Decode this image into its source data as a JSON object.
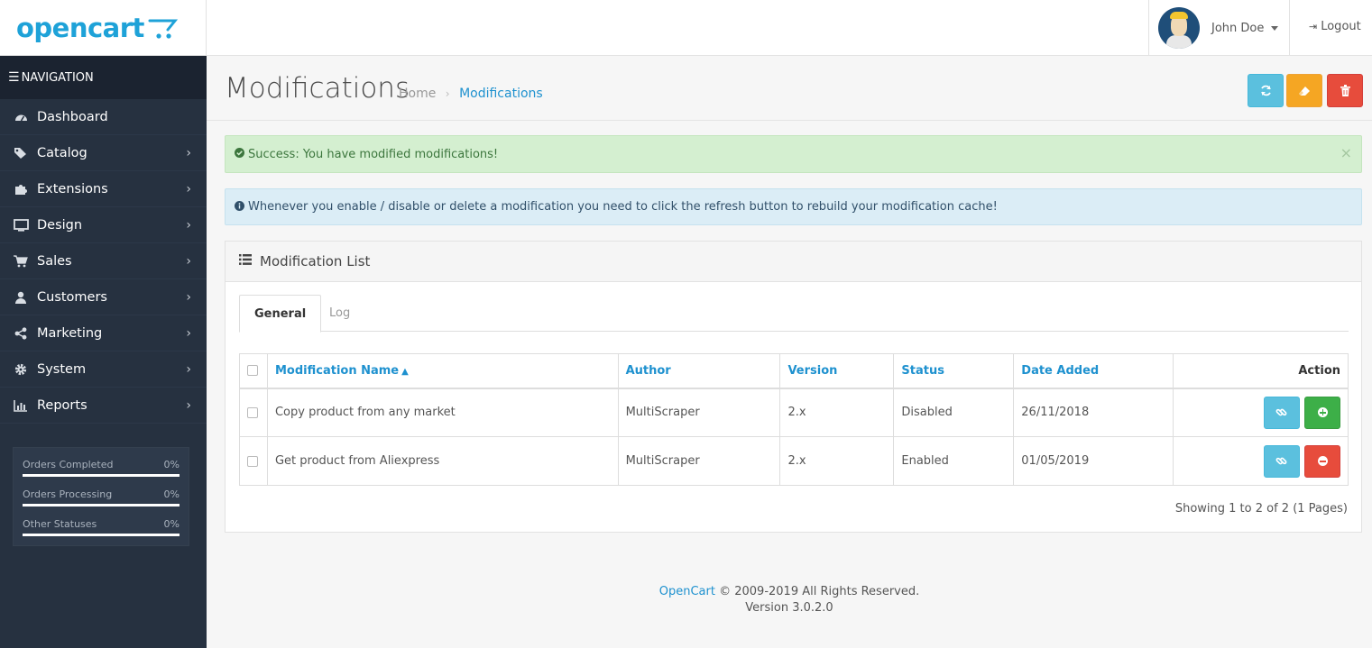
{
  "header": {
    "logo_text": "opencart",
    "user_name": "John Doe",
    "logout_label": "Logout"
  },
  "sidebar": {
    "nav_title": "NAVIGATION",
    "items": [
      {
        "label": "Dashboard",
        "icon": "dashboard-icon",
        "has_children": false
      },
      {
        "label": "Catalog",
        "icon": "tags-icon",
        "has_children": true
      },
      {
        "label": "Extensions",
        "icon": "puzzle-icon",
        "has_children": true
      },
      {
        "label": "Design",
        "icon": "desktop-icon",
        "has_children": true
      },
      {
        "label": "Sales",
        "icon": "cart-icon",
        "has_children": true
      },
      {
        "label": "Customers",
        "icon": "user-icon",
        "has_children": true
      },
      {
        "label": "Marketing",
        "icon": "share-icon",
        "has_children": true
      },
      {
        "label": "System",
        "icon": "gear-icon",
        "has_children": true
      },
      {
        "label": "Reports",
        "icon": "bar-chart-icon",
        "has_children": true
      }
    ],
    "stats": [
      {
        "label": "Orders Completed",
        "value": "0%"
      },
      {
        "label": "Orders Processing",
        "value": "0%"
      },
      {
        "label": "Other Statuses",
        "value": "0%"
      }
    ]
  },
  "page": {
    "title": "Modifications",
    "breadcrumb": {
      "home": "Home",
      "current": "Modifications"
    }
  },
  "alerts": {
    "success": "Success: You have modified modifications!",
    "info": "Whenever you enable / disable or delete a modification you need to click the refresh button to rebuild your modification cache!"
  },
  "panel": {
    "title": "Modification List",
    "tabs": [
      {
        "label": "General",
        "active": true
      },
      {
        "label": "Log",
        "active": false
      }
    ],
    "columns": {
      "name": "Modification Name",
      "author": "Author",
      "version": "Version",
      "status": "Status",
      "date_added": "Date Added",
      "action": "Action"
    },
    "rows": [
      {
        "name": "Copy product from any market",
        "author": "MultiScraper",
        "version": "2.x",
        "status": "Disabled",
        "date_added": "26/11/2018",
        "toggle": "enable"
      },
      {
        "name": "Get product from Aliexpress",
        "author": "MultiScraper",
        "version": "2.x",
        "status": "Enabled",
        "date_added": "01/05/2019",
        "toggle": "disable"
      }
    ],
    "pagination_info": "Showing 1 to 2 of 2 (1 Pages)"
  },
  "footer": {
    "brand": "OpenCart",
    "copyright": " © 2009-2019 All Rights Reserved.",
    "version": "Version 3.0.2.0"
  },
  "colors": {
    "accent": "#1e91cf",
    "sidebar_bg": "#263140",
    "info_button": "#5bc0de",
    "warning_button": "#f5a623",
    "danger_button": "#e74c3c",
    "success_button": "#3daf48"
  }
}
